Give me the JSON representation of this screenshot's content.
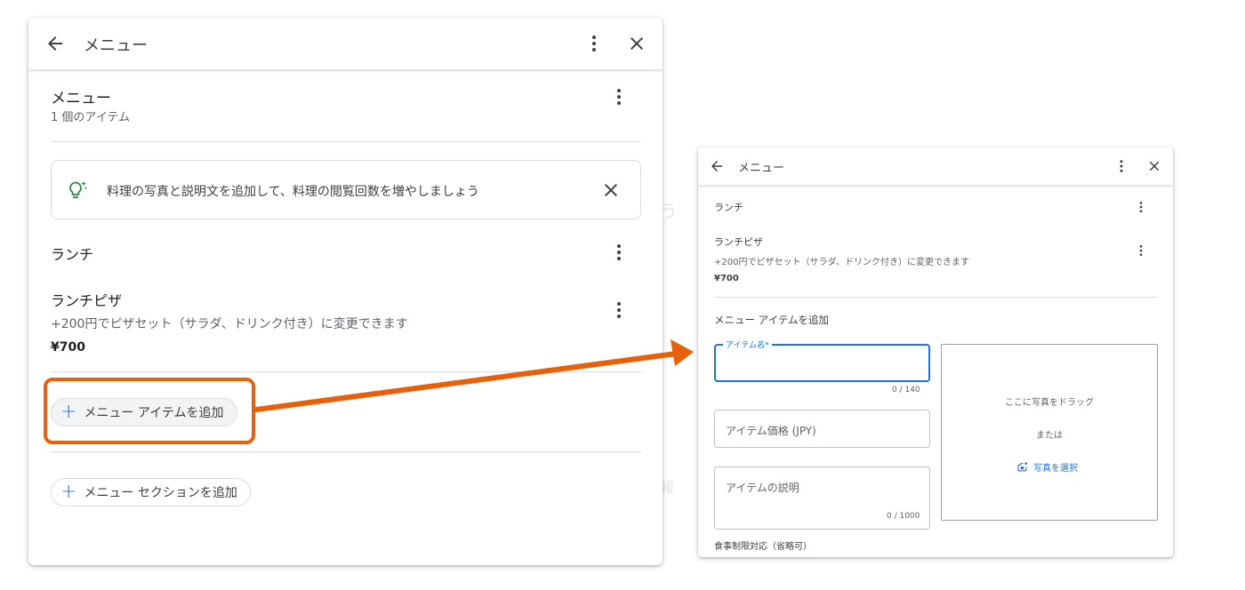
{
  "left_panel": {
    "header": {
      "title": "メニュー"
    },
    "menu": {
      "title": "メニュー",
      "item_count": "1 個のアイテム"
    },
    "tip": {
      "text": "料理の写真と説明文を追加して、料理の閲覧回数を増やしましょう"
    },
    "section": {
      "name": "ランチ"
    },
    "item": {
      "name": "ランチピザ",
      "description": "+200円でピザセット（サラダ、ドリンク付き）に変更できます",
      "price": "¥700"
    },
    "add_item_button": "メニュー アイテムを追加",
    "add_section_button": "メニュー セクションを追加"
  },
  "right_panel": {
    "header": {
      "title": "メニュー"
    },
    "section": {
      "name": "ランチ"
    },
    "item": {
      "name": "ランチピザ",
      "description": "+200円でピザセット（サラダ、ドリンク付き）に変更できます",
      "price": "¥700"
    },
    "form": {
      "heading": "メニュー アイテムを追加",
      "name_label": "アイテム名*",
      "name_value": "",
      "name_counter": "0 / 140",
      "price_placeholder": "アイテム価格 (JPY)",
      "description_placeholder": "アイテムの説明",
      "description_counter": "0 / 1000",
      "dietary_label": "食事制限対応（省略可）"
    },
    "photo": {
      "drop_text": "ここに写真をドラッグ",
      "or_text": "または",
      "select_label": "写真を選択"
    }
  },
  "colors": {
    "accent": "#1a73e8",
    "highlight": "#e8600a",
    "tip_icon": "#1e8e3e"
  }
}
